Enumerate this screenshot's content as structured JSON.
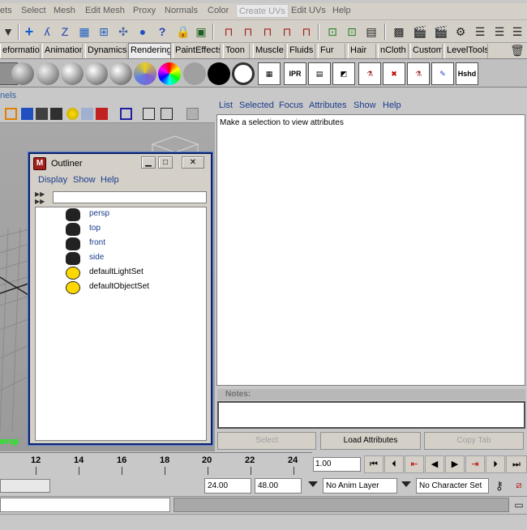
{
  "menubar": {
    "items": [
      "ets",
      "Select",
      "Mesh",
      "Edit Mesh",
      "Proxy",
      "Normals",
      "Color",
      "Create UVs",
      "Edit UVs",
      "Help"
    ]
  },
  "shelf_tabs": [
    "eformation",
    "Animation",
    "Dynamics",
    "Rendering",
    "PaintEffects",
    "Toon",
    "Muscle",
    "Fluids",
    "Fur",
    "Hair",
    "nCloth",
    "Custom",
    "LevelTools"
  ],
  "shelf_selected": "Rendering",
  "shelf_icon_labels": {
    "ipr": "IPR",
    "hshd": "Hshd"
  },
  "panels_label": "nels",
  "viewport_label": "ersp",
  "attribute_editor": {
    "menu": [
      "List",
      "Selected",
      "Focus",
      "Attributes",
      "Show",
      "Help"
    ],
    "message": "Make a selection to view attributes",
    "notes_label": "Notes:",
    "buttons": {
      "select": "Select",
      "load": "Load Attributes",
      "copy_tab": "Copy Tab"
    }
  },
  "outliner": {
    "title": "Outliner",
    "menu": [
      "Display",
      "Show",
      "Help"
    ],
    "filter_value": "",
    "items": [
      {
        "label": "persp",
        "icon": "camera-icon",
        "color": "#1a3c8c"
      },
      {
        "label": "top",
        "icon": "camera-icon",
        "color": "#1a3c8c"
      },
      {
        "label": "front",
        "icon": "camera-icon",
        "color": "#1a3c8c"
      },
      {
        "label": "side",
        "icon": "camera-icon",
        "color": "#1a3c8c"
      },
      {
        "label": "defaultLightSet",
        "icon": "set-icon",
        "color": "#000000"
      },
      {
        "label": "defaultObjectSet",
        "icon": "set-icon",
        "color": "#000000"
      }
    ]
  },
  "timeline": {
    "ticks": [
      "12",
      "14",
      "16",
      "18",
      "20",
      "22",
      "24"
    ],
    "current_frame": "1.00"
  },
  "range": {
    "end_time": "24.00",
    "playback_end": "48.00",
    "anim_layer": "No Anim Layer",
    "character_set": "No Character Set"
  }
}
